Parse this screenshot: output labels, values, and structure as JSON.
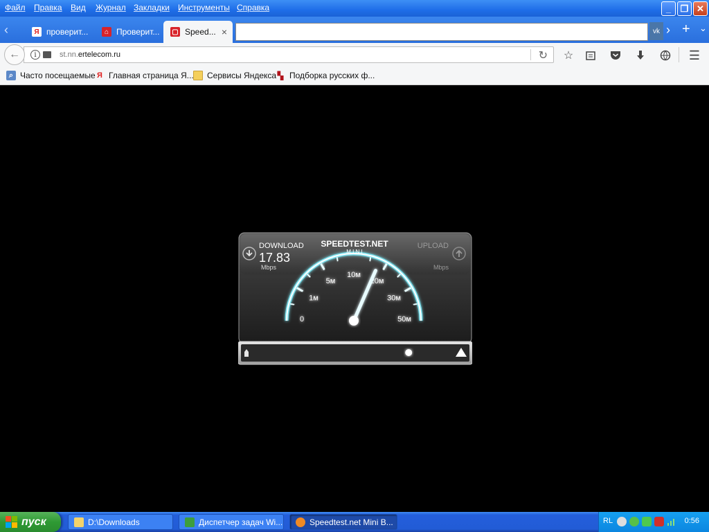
{
  "menu": {
    "items": [
      "Файл",
      "Правка",
      "Вид",
      "Журнал",
      "Закладки",
      "Инструменты",
      "Справка"
    ]
  },
  "window_controls": {
    "minimize": "_",
    "restore": "❐",
    "close": "✕"
  },
  "tabs": [
    {
      "label": "проверит...",
      "favicon": "Я",
      "favicon_color": "#ffffff",
      "favicon_text": "#e02020",
      "active": false
    },
    {
      "label": "Проверит...",
      "favicon": "⌂",
      "favicon_color": "#d8232a",
      "favicon_text": "#ffffff",
      "active": false
    },
    {
      "label": "Speed...",
      "favicon": "▢",
      "favicon_color": "#d8232a",
      "favicon_text": "#ffffff",
      "active": true,
      "close": "×"
    }
  ],
  "tabbar": {
    "new_tab": "+",
    "scroll_right": "›",
    "list": "⌄",
    "vk": "vk"
  },
  "navbar": {
    "url_prefix": "st.nn.",
    "url_domain": "ertelecom.ru"
  },
  "bookmarks": [
    {
      "label": "Часто посещаемые",
      "icon": "search-icon"
    },
    {
      "label": "Главная страница Я...",
      "icon": "yandex-icon"
    },
    {
      "label": "Сервисы Яндекса",
      "icon": "folder-icon"
    },
    {
      "label": "Подборка русских ф...",
      "icon": "film-icon"
    }
  ],
  "speedtest": {
    "download_label": "DOWNLOAD",
    "download_value": "17.83",
    "download_unit": "Mbps",
    "logo_top": "SPEEDTEST.NET",
    "logo_bottom": "M I N I",
    "upload_label": "UPLOAD",
    "upload_unit": "Mbps",
    "gauge_labels": [
      "0",
      "1м",
      "5м",
      "10м",
      "20м",
      "30м",
      "50м"
    ],
    "needle_value_mbps": 17.83,
    "progress_fraction": 0.78
  },
  "taskbar": {
    "start_label": "пуск",
    "tasks": [
      {
        "label": "D:\\Downloads",
        "icon_color": "#f3d36b",
        "active": false
      },
      {
        "label": "Диспетчер задач Wi...",
        "icon_color": "#3d9e3d",
        "active": false
      },
      {
        "label": "Speedtest.net Mini B...",
        "icon_color": "#f08a24",
        "active": true
      }
    ],
    "tray_lang": "RL",
    "clock": "0:56"
  }
}
